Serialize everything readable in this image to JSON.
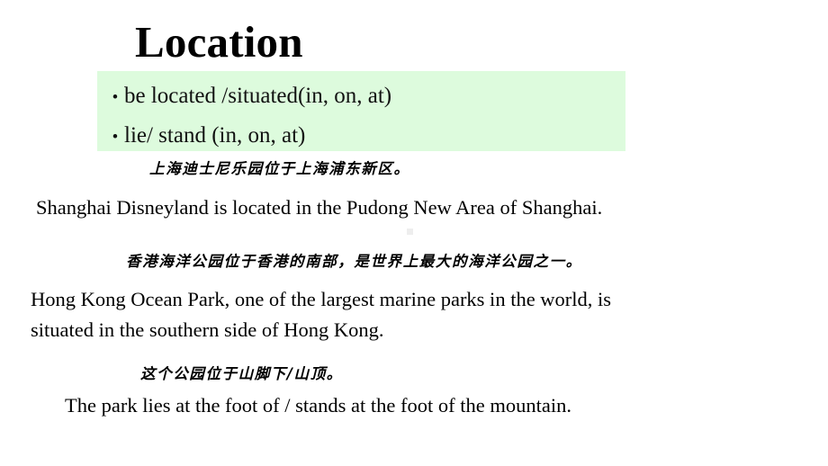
{
  "slide": {
    "title": "Location",
    "background_color": "#ffffff",
    "highlight_box": {
      "background_color": "#ddfbdd",
      "bullet_glyph": "•",
      "items": [
        "be located /situated(in, on, at)",
        "lie/ stand (in, on, at)"
      ]
    },
    "examples": [
      {
        "chinese": "上海迪士尼乐园位于上海浦东新区。",
        "english": "Shanghai Disneyland is located in the Pudong New Area of Shanghai."
      },
      {
        "chinese": "香港海洋公园位于香港的南部，是世界上最大的海洋公园之一。",
        "english_line_1": "Hong Kong Ocean Park, one of the largest marine parks in the world, is",
        "english_line_2": "situated in the southern side of Hong Kong."
      },
      {
        "chinese": "这个公园位于山脚下/山顶。",
        "english": "The park lies at the foot of / stands at the foot of the mountain."
      }
    ]
  }
}
